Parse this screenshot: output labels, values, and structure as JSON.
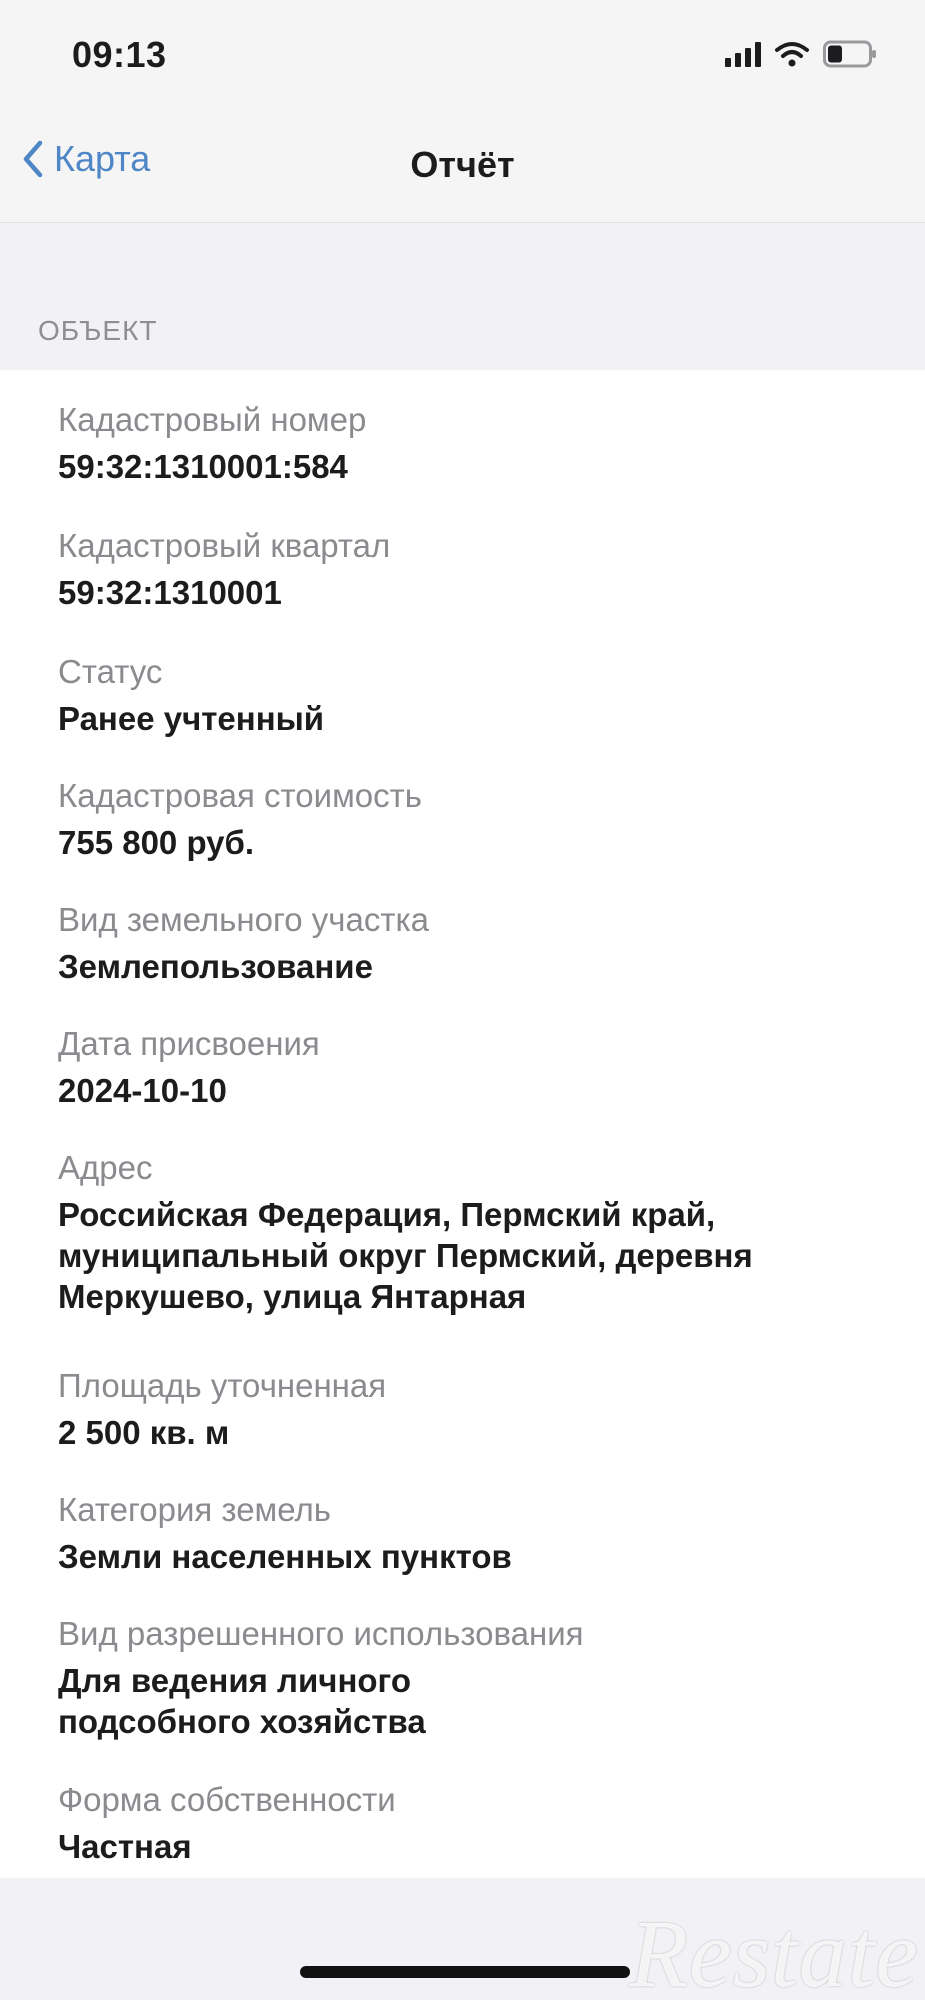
{
  "status_bar": {
    "time": "09:13",
    "icons": [
      "signal-icon",
      "wifi-icon",
      "battery-icon"
    ]
  },
  "nav": {
    "back_label": "Карта",
    "title": "Отчёт"
  },
  "section": {
    "header": "ОБЪЕКТ"
  },
  "fields": [
    {
      "label": "Кадастровый номер",
      "value": "59:32:1310001:584"
    },
    {
      "label": "Кадастровый квартал",
      "value": "59:32:1310001"
    },
    {
      "label": "Статус",
      "value": "Ранее учтенный"
    },
    {
      "label": "Кадастровая стоимость",
      "value": "755 800 руб."
    },
    {
      "label": "Вид земельного участка",
      "value": "Землепользование"
    },
    {
      "label": "Дата присвоения",
      "value": "2024-10-10"
    },
    {
      "label": "Адрес",
      "value": "Российская Федерация, Пермский край, муниципальный округ Пермский, деревня Меркушево, улица Янтарная"
    },
    {
      "label": "Площадь уточненная",
      "value": "2 500 кв. м"
    },
    {
      "label": "Категория земель",
      "value": "Земли населенных пунктов"
    },
    {
      "label": "Вид разрешенного использования",
      "value": "Для ведения личного подсобного хозяйства"
    },
    {
      "label": "Форма собственности",
      "value": "Частная"
    }
  ],
  "watermark": "Restate",
  "colors": {
    "accent": "#4f86c6",
    "label": "#8a8a8f",
    "background": "#f2f2f6",
    "card": "#ffffff"
  }
}
